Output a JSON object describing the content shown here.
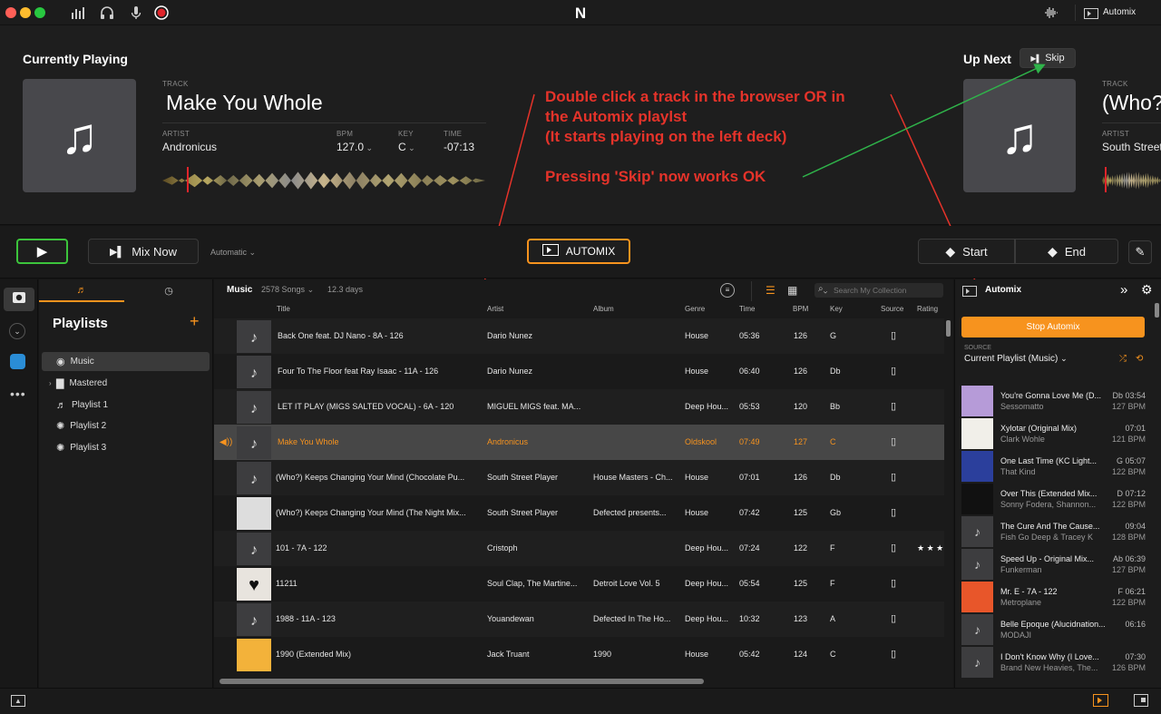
{
  "app": {
    "logo": "N",
    "output_label": "Automix"
  },
  "colors": {
    "accent": "#f7931e",
    "annotation": "#e5332a",
    "play_green": "#3cc43c",
    "bg": "#1e1e1e"
  },
  "now_playing": {
    "section_title": "Currently Playing",
    "track_label": "TRACK",
    "track": "Make You Whole",
    "artist_label": "ARTIST",
    "artist": "Andronicus",
    "bpm_label": "BPM",
    "bpm": "127.0",
    "key_label": "KEY",
    "key": "C",
    "time_label": "TIME",
    "time": "-07:13"
  },
  "up_next": {
    "section_title": "Up Next",
    "skip_label": "Skip",
    "track_label": "TRACK",
    "track": "(Who?",
    "artist_label": "ARTIST",
    "artist": "South Street"
  },
  "annotations": {
    "line1": "Double click a track in the browser OR in",
    "line2": "the Automix playlst",
    "line3": "(It starts playing on the left deck)",
    "line4": "Pressing 'Skip' now works OK"
  },
  "transport": {
    "mix_now": "Mix Now",
    "mode": "Automatic",
    "automix": "AUTOMIX",
    "start": "Start",
    "end": "End"
  },
  "sidebar": {
    "title": "Playlists",
    "items": [
      {
        "label": "Music"
      },
      {
        "label": "Mastered"
      },
      {
        "label": "Playlist 1"
      },
      {
        "label": "Playlist 2"
      },
      {
        "label": "Playlist 3"
      }
    ]
  },
  "browser": {
    "section": "Music",
    "song_count": "2578 Songs",
    "duration": "12.3 days",
    "search_placeholder": "Search My Collection",
    "columns": {
      "title": "Title",
      "artist": "Artist",
      "album": "Album",
      "genre": "Genre",
      "time": "Time",
      "bpm": "BPM",
      "key": "Key",
      "source": "Source",
      "rating": "Rating"
    },
    "rows": [
      {
        "title": "Back One feat. DJ Nano - 8A - 126",
        "artist": "Dario Nunez",
        "album": "",
        "genre": "House",
        "time": "05:36",
        "bpm": "126",
        "key": "G"
      },
      {
        "title": "Four To The Floor feat Ray Isaac - 11A - 126",
        "artist": "Dario Nunez",
        "album": "",
        "genre": "House",
        "time": "06:40",
        "bpm": "126",
        "key": "Db"
      },
      {
        "title": "LET IT PLAY (MIGS SALTED VOCAL) - 6A - 120",
        "artist": "MIGUEL MIGS feat. MA...",
        "album": "",
        "genre": "Deep Hou...",
        "time": "05:53",
        "bpm": "120",
        "key": "Bb"
      },
      {
        "title": "Make You Whole",
        "artist": "Andronicus",
        "album": "",
        "genre": "Oldskool",
        "time": "07:49",
        "bpm": "127",
        "key": "C"
      },
      {
        "title": "(Who?) Keeps Changing Your Mind (Chocolate Pu...",
        "artist": "South Street Player",
        "album": "House Masters - Ch...",
        "genre": "House",
        "time": "07:01",
        "bpm": "126",
        "key": "Db"
      },
      {
        "title": "(Who?) Keeps Changing Your Mind (The Night Mix...",
        "artist": "South Street Player",
        "album": "Defected presents...",
        "genre": "House",
        "time": "07:42",
        "bpm": "125",
        "key": "Gb"
      },
      {
        "title": "101 - 7A - 122",
        "artist": "Cristoph",
        "album": "",
        "genre": "Deep Hou...",
        "time": "07:24",
        "bpm": "122",
        "key": "F"
      },
      {
        "title": "11211",
        "artist": "Soul Clap, The Martine...",
        "album": "Detroit Love Vol. 5",
        "genre": "Deep Hou...",
        "time": "05:54",
        "bpm": "125",
        "key": "F"
      },
      {
        "title": "1988 - 11A - 123",
        "artist": "Youandewan",
        "album": "Defected In The Ho...",
        "genre": "Deep Hou...",
        "time": "10:32",
        "bpm": "123",
        "key": "A"
      },
      {
        "title": "1990 (Extended Mix)",
        "artist": "Jack Truant",
        "album": "1990",
        "genre": "House",
        "time": "05:42",
        "bpm": "124",
        "key": "C"
      }
    ]
  },
  "automix_panel": {
    "title": "Automix",
    "stop_label": "Stop Automix",
    "source_label": "SOURCE",
    "source_value": "Current Playlist (Music)",
    "items": [
      {
        "title": "You're Gonna Love Me (D...",
        "artist": "Sessomatto",
        "key_time": "Db 03:54",
        "bpm": "127 BPM"
      },
      {
        "title": "Xylotar (Original Mix)",
        "artist": "Clark Wohle",
        "key_time": "07:01",
        "bpm": "121 BPM"
      },
      {
        "title": "One Last Time (KC Light...",
        "artist": "That Kind",
        "key_time": "G 05:07",
        "bpm": "122 BPM"
      },
      {
        "title": "Over This (Extended Mix...",
        "artist": "Sonny Fodera, Shannon...",
        "key_time": "D 07:12",
        "bpm": "122 BPM"
      },
      {
        "title": "The Cure And The Cause...",
        "artist": "Fish Go Deep & Tracey K",
        "key_time": "09:04",
        "bpm": "128 BPM"
      },
      {
        "title": "Speed Up - Original Mix...",
        "artist": "Funkerman",
        "key_time": "Ab 06:39",
        "bpm": "127 BPM"
      },
      {
        "title": "Mr. E - 7A - 122",
        "artist": "Metroplane",
        "key_time": "F 06:21",
        "bpm": "122 BPM"
      },
      {
        "title": "Belle Epoque (Alucidnation...",
        "artist": "MODAJI",
        "key_time": "06:16",
        "bpm": ""
      },
      {
        "title": "I Don't Know Why (I Love...",
        "artist": "Brand New Heavies, The...",
        "key_time": "07:30",
        "bpm": "126 BPM"
      }
    ]
  }
}
